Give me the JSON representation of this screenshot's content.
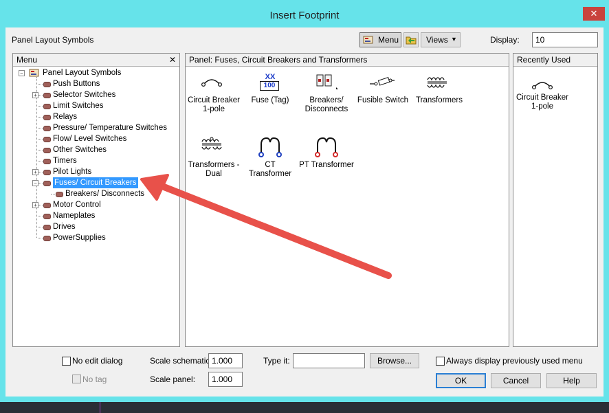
{
  "window": {
    "title": "Insert Footprint",
    "close_glyph": "✕"
  },
  "toolbar": {
    "library_label": "Panel Layout Symbols",
    "menu_label": "Menu",
    "views_label": "Views",
    "views_arrow": "▼",
    "display_label": "Display:",
    "display_value": "10"
  },
  "menu_panel": {
    "header": "Menu",
    "close_glyph": "✕",
    "root": "Panel Layout Symbols",
    "items": [
      "Push Buttons",
      "Selector Switches",
      "Limit Switches",
      "Relays",
      "Pressure/ Temperature Switches",
      "Flow/ Level Switches",
      "Other Switches",
      "Timers",
      "Pilot Lights",
      "Fuses/ Circuit Breakers",
      "Breakers/ Disconnects",
      "Motor Control",
      "Nameplates",
      "Drives",
      "PowerSupplies"
    ]
  },
  "symbols_panel": {
    "header": "Panel: Fuses, Circuit Breakers and Transformers",
    "symbols": [
      {
        "line1": "Circuit Breaker",
        "line2": "1-pole"
      },
      {
        "line1": "Fuse (Tag)",
        "line2": "",
        "tag_top": "XX",
        "tag_box": "100"
      },
      {
        "line1": "Breakers/",
        "line2": "Disconnects"
      },
      {
        "line1": "Fusible Switch",
        "line2": ""
      },
      {
        "line1": "Transformers",
        "line2": ""
      },
      {
        "line1": "Transformers -",
        "line2": "Dual"
      },
      {
        "line1": "CT Transformer",
        "line2": ""
      },
      {
        "line1": "PT Transformer",
        "line2": ""
      }
    ]
  },
  "recent_panel": {
    "header": "Recently Used",
    "item": {
      "line1": "Circuit Breaker",
      "line2": "1-pole"
    }
  },
  "footer": {
    "no_edit_dialog": "No edit dialog",
    "no_tag": "No tag",
    "scale_schematic_label": "Scale schematic:",
    "scale_schematic_value": "1.000",
    "scale_panel_label": "Scale panel:",
    "scale_panel_value": "1.000",
    "type_it_label": "Type it:",
    "type_it_value": "",
    "browse_label": "Browse...",
    "always_display_label": "Always display previously used menu",
    "ok_label": "OK",
    "cancel_label": "Cancel",
    "help_label": "Help"
  },
  "colors": {
    "titlebar": "#66e3ea",
    "selection": "#3399ff",
    "arrow": "#e8514a",
    "ct_terminal": "#1e3fbf",
    "pt_terminal": "#d42a2a"
  }
}
